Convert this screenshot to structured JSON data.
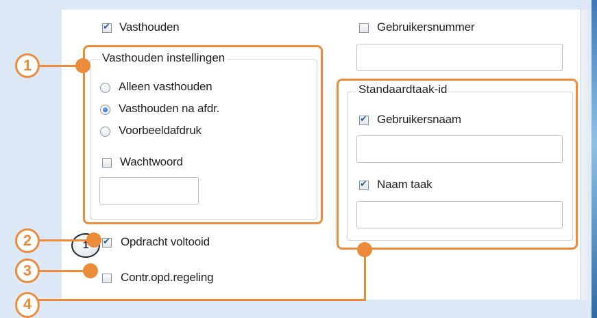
{
  "colors": {
    "accent": "#ec8b3a",
    "check": "#2a5da6"
  },
  "left_column": {
    "hold": {
      "label": "Vasthouden",
      "checked": true
    },
    "hold_settings": {
      "title": "Vasthouden instellingen",
      "options": [
        {
          "label": "Alleen vasthouden",
          "selected": false
        },
        {
          "label": "Vasthouden na afdr.",
          "selected": true
        },
        {
          "label": "Voorbeeldafdruk",
          "selected": false
        }
      ],
      "password": {
        "label": "Wachtwoord",
        "checked": false,
        "value": ""
      }
    },
    "job_complete": {
      "label": "Opdracht voltooid",
      "checked": true,
      "icon_text": "1"
    },
    "job_control": {
      "label": "Contr.opd.regeling",
      "checked": false
    }
  },
  "right_column": {
    "user_number": {
      "label": "Gebruikersnummer",
      "checked": false,
      "value": ""
    },
    "default_job_id": {
      "title": "Standaardtaak-id",
      "user_name": {
        "label": "Gebruikersnaam",
        "checked": true,
        "value": ""
      },
      "job_name": {
        "label": "Naam taak",
        "checked": true,
        "value": ""
      }
    }
  },
  "callouts": [
    "1",
    "2",
    "3",
    "4"
  ]
}
